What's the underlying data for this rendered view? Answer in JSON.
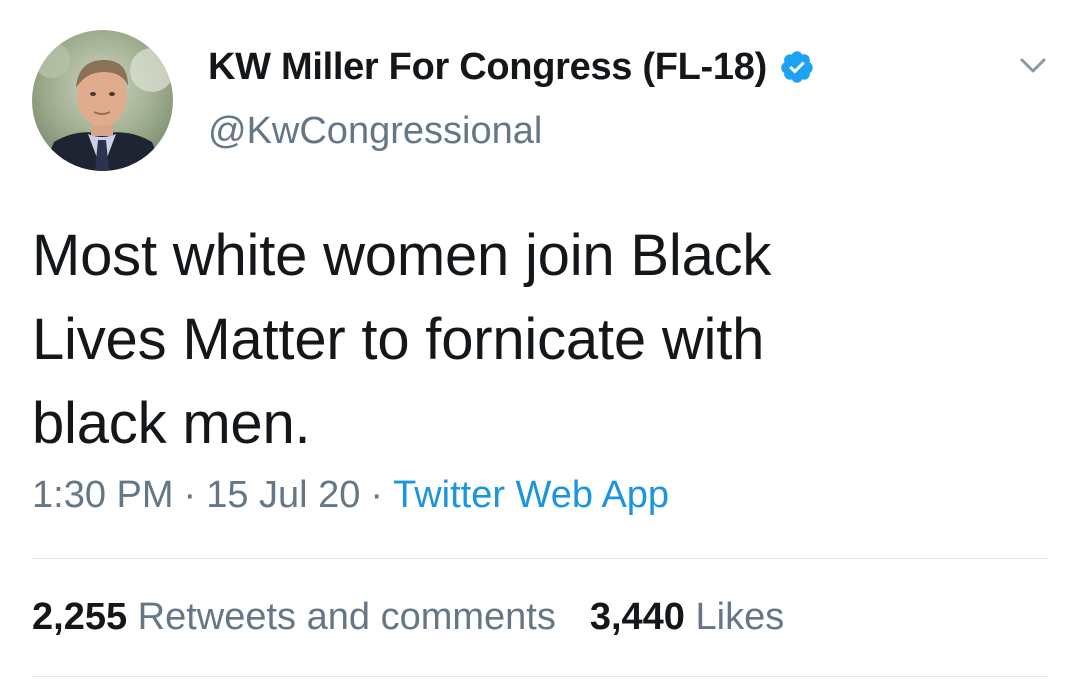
{
  "author": {
    "display_name": "KW Miller For Congress (FL-18)",
    "handle": "@KwCongressional",
    "verified": true
  },
  "tweet": {
    "text_lines": [
      "Most white women join Black",
      "Lives Matter to fornicate with",
      "black men."
    ]
  },
  "meta": {
    "time": "1:30 PM",
    "separator": "·",
    "date": "15 Jul 20",
    "source": "Twitter Web App"
  },
  "stats": {
    "retweets_count": "2,255",
    "retweets_label": "Retweets and comments",
    "likes_count": "3,440",
    "likes_label": "Likes"
  },
  "colors": {
    "text_primary": "#14171a",
    "text_secondary": "#657786",
    "link": "#1b95e0",
    "verified_badge": "#1da1f2",
    "divider": "#e1e8ed"
  },
  "icons": {
    "verified": "verified-badge-icon",
    "menu": "chevron-down-icon"
  }
}
